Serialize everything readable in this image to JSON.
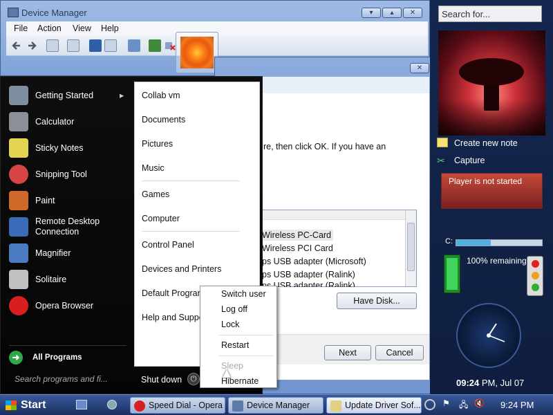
{
  "device_manager": {
    "title": "Device Manager",
    "controls": [
      "▾",
      "▴",
      "✕"
    ],
    "menus": [
      "File",
      "Action",
      "View",
      "Help"
    ]
  },
  "driver_dialog": {
    "instruction_text": "re, then click OK. If you have an",
    "list_items": [
      "Wireless PC-Card",
      "Wireless PCI Card",
      "ps USB adapter (Microsoft)",
      "ps USB adapter (Ralink)",
      "ps USB adapter (Ralink)"
    ],
    "have_disk_label": "Have Disk...",
    "next_label": "Next",
    "cancel_label": "Cancel"
  },
  "start_menu": {
    "programs": [
      {
        "label": "Getting Started",
        "icon": "getting-started-icon",
        "color": "#7f8fa0"
      },
      {
        "label": "Calculator",
        "icon": "calculator-icon",
        "color": "#8a8f98"
      },
      {
        "label": "Sticky Notes",
        "icon": "sticky-notes-icon",
        "color": "#e3d552"
      },
      {
        "label": "Snipping Tool",
        "icon": "scissors-icon",
        "color": "#d64545"
      },
      {
        "label": "Paint",
        "icon": "paint-icon",
        "color": "#d06a2a"
      },
      {
        "label": "Remote Desktop Connection",
        "icon": "remote-desktop-icon",
        "color": "#3a6ab8"
      },
      {
        "label": "Magnifier",
        "icon": "magnifier-icon",
        "color": "#4a7ac0"
      },
      {
        "label": "Solitaire",
        "icon": "solitaire-icon",
        "color": "#c0c0c0"
      },
      {
        "label": "Opera Browser",
        "icon": "opera-icon",
        "color": "#d81e1e"
      }
    ],
    "all_programs": "All Programs",
    "search_placeholder": "Search programs and fi...",
    "right_items": [
      "Collab vm",
      "Documents",
      "Pictures",
      "Music",
      "Games",
      "Computer",
      "Control Panel",
      "Devices and Printers",
      "Default Programs",
      "Help and Support"
    ],
    "shutdown_label": "Shut down",
    "shutdown_menu": [
      "Switch user",
      "Log off",
      "Lock",
      "Restart",
      "Sleep",
      "Hibernate"
    ]
  },
  "sidebar": {
    "search_placeholder": "Search for...",
    "notes_label": "Create new note",
    "capture_label": "Capture",
    "player_status": "Player is not started",
    "cpu_label": "C:",
    "battery_text": "100% remaining",
    "clock_time": "09:24",
    "clock_suffix": " PM, Jul 07"
  },
  "taskbar": {
    "start_label": "Start",
    "tasks": [
      "Speed Dial - Opera",
      "Device Manager",
      "Update Driver Sof..."
    ],
    "time": "9:24 PM"
  }
}
